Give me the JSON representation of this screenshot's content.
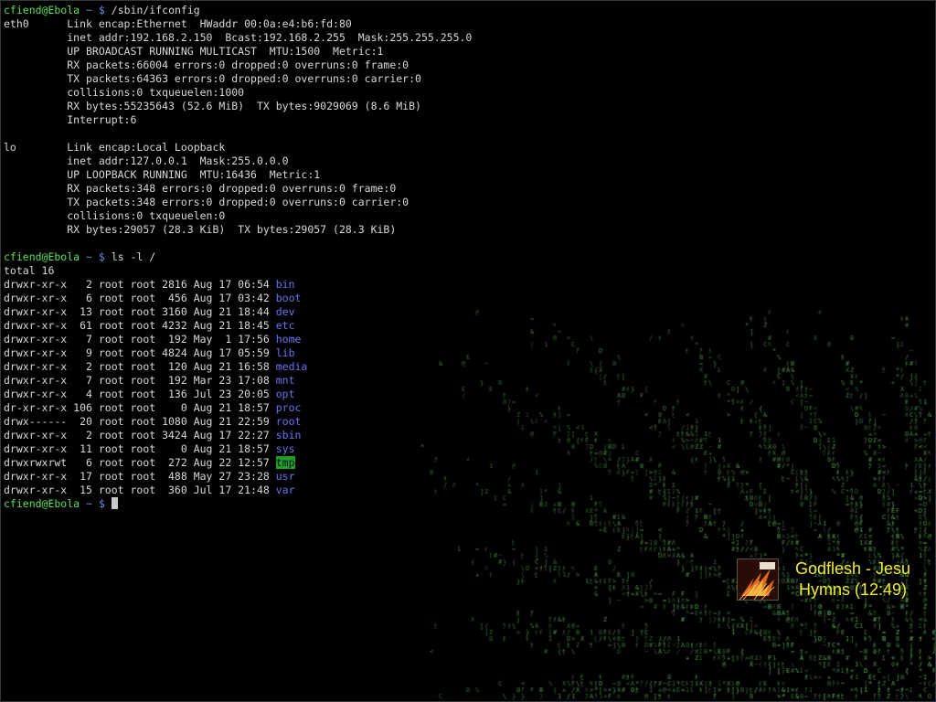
{
  "terminal": {
    "lines": [
      {
        "prompt": {
          "user": "cfiend@Ebola",
          "path": "~",
          "sym": "$"
        },
        "cmd": " /sbin/ifconfig"
      },
      {
        "text": "eth0      Link encap:Ethernet  HWaddr 00:0a:e4:b6:fd:80"
      },
      {
        "text": "          inet addr:192.168.2.150  Bcast:192.168.2.255  Mask:255.255.255.0"
      },
      {
        "text": "          UP BROADCAST RUNNING MULTICAST  MTU:1500  Metric:1"
      },
      {
        "text": "          RX packets:66004 errors:0 dropped:0 overruns:0 frame:0"
      },
      {
        "text": "          TX packets:64363 errors:0 dropped:0 overruns:0 carrier:0"
      },
      {
        "text": "          collisions:0 txqueuelen:1000"
      },
      {
        "text": "          RX bytes:55235643 (52.6 MiB)  TX bytes:9029069 (8.6 MiB)"
      },
      {
        "text": "          Interrupt:6"
      },
      {
        "text": ""
      },
      {
        "text": "lo        Link encap:Local Loopback"
      },
      {
        "text": "          inet addr:127.0.0.1  Mask:255.0.0.0"
      },
      {
        "text": "          UP LOOPBACK RUNNING  MTU:16436  Metric:1"
      },
      {
        "text": "          RX packets:348 errors:0 dropped:0 overruns:0 frame:0"
      },
      {
        "text": "          TX packets:348 errors:0 dropped:0 overruns:0 carrier:0"
      },
      {
        "text": "          collisions:0 txqueuelen:0"
      },
      {
        "text": "          RX bytes:29057 (28.3 KiB)  TX bytes:29057 (28.3 KiB)"
      },
      {
        "text": ""
      },
      {
        "prompt": {
          "user": "cfiend@Ebola",
          "path": "~",
          "sym": "$"
        },
        "cmd": " ls -l /"
      },
      {
        "text": "total 16"
      },
      {
        "text": "drwxr-xr-x   2 root root 2816 Aug 17 06:54 ",
        "dir": "bin"
      },
      {
        "text": "drwxr-xr-x   6 root root  456 Aug 17 03:42 ",
        "dir": "boot"
      },
      {
        "text": "drwxr-xr-x  13 root root 3160 Aug 21 18:44 ",
        "dir": "dev"
      },
      {
        "text": "drwxr-xr-x  61 root root 4232 Aug 21 18:45 ",
        "dir": "etc"
      },
      {
        "text": "drwxr-xr-x   7 root root  192 May  1 17:56 ",
        "dir": "home"
      },
      {
        "text": "drwxr-xr-x   9 root root 4824 Aug 17 05:59 ",
        "dir": "lib"
      },
      {
        "text": "drwxr-xr-x   2 root root  120 Aug 21 16:58 ",
        "dir": "media"
      },
      {
        "text": "drwxr-xr-x   7 root root  192 Mar 23 17:08 ",
        "dir": "mnt"
      },
      {
        "text": "drwxr-xr-x   4 root root  136 Jul 23 20:05 ",
        "dir": "opt"
      },
      {
        "text": "dr-xr-xr-x 106 root root    0 Aug 21 18:57 ",
        "dir": "proc"
      },
      {
        "text": "drwx------  20 root root 1080 Aug 21 22:59 ",
        "dir": "root"
      },
      {
        "text": "drwxr-xr-x   2 root root 3424 Aug 17 22:27 ",
        "dir": "sbin"
      },
      {
        "text": "drwxr-xr-x  11 root root    0 Aug 21 18:57 ",
        "dir": "sys"
      },
      {
        "text": "drwxrwxrwt   6 root root  272 Aug 22 12:57 ",
        "dir": "tmp",
        "sticky": true
      },
      {
        "text": "drwxr-xr-x  17 root root  488 May 27 23:28 ",
        "dir": "usr"
      },
      {
        "text": "drwxr-xr-x  15 root root  360 Jul 17 21:48 ",
        "dir": "var"
      },
      {
        "prompt": {
          "user": "cfiend@Ebola",
          "path": "~",
          "sym": "$"
        },
        "cmd": " ",
        "cursor": true
      }
    ]
  },
  "now_playing": {
    "line1": "Godflesh - Jesu",
    "line2": "Hymns (12:49)",
    "text_color": "#f1ec2b"
  },
  "colors": {
    "prompt_user": "#5be05b",
    "prompt_path": "#7a7ae8",
    "directory": "#6a72f0",
    "sticky_dir_bg": "#1fa01f",
    "terminal_text": "#d8d8d8",
    "wallpaper_glyphs": "#3fae3f"
  }
}
